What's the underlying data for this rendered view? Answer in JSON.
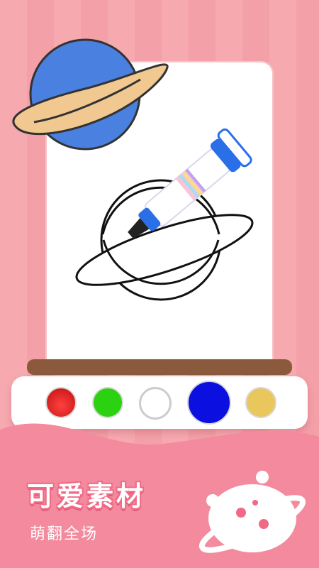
{
  "footer": {
    "title": "可爱素材",
    "subtitle": "萌翻全场"
  },
  "palette": {
    "colors": [
      {
        "name": "red",
        "hex": "#e01f1f"
      },
      {
        "name": "green",
        "hex": "#2bd20f"
      },
      {
        "name": "white",
        "hex": "#ffffff"
      },
      {
        "name": "blue",
        "hex": "#0b0fe0"
      },
      {
        "name": "yellow",
        "hex": "#e9c75c"
      }
    ],
    "selected": "blue"
  },
  "sample_planet": {
    "body_color": "#4a80e0",
    "ring_color": "#f0c890"
  },
  "icons": [
    "planet-sticker-icon",
    "marker-pen-icon",
    "planet-logo-icon"
  ]
}
